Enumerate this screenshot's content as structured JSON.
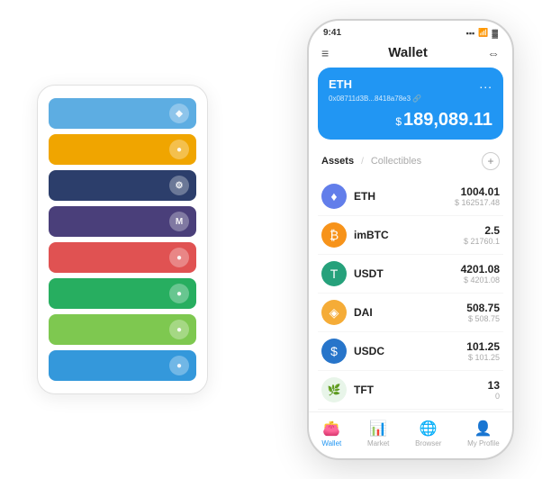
{
  "scene": {
    "card_stack": {
      "items": [
        {
          "color": "#5DADE2",
          "icon": "◆"
        },
        {
          "color": "#F0A500",
          "icon": "●"
        },
        {
          "color": "#2C3E6B",
          "icon": "⚙"
        },
        {
          "color": "#4A3F7A",
          "icon": "M"
        },
        {
          "color": "#E05252",
          "icon": "●"
        },
        {
          "color": "#27AE60",
          "icon": "●"
        },
        {
          "color": "#7EC850",
          "icon": "●"
        },
        {
          "color": "#3498DB",
          "icon": "●"
        }
      ]
    }
  },
  "phone": {
    "status_bar": {
      "time": "9:41",
      "signal": "▪▪▪",
      "wifi": "WiFi",
      "battery": "🔋"
    },
    "header": {
      "menu_icon": "≡",
      "title": "Wallet",
      "expand_icon": "⇔"
    },
    "eth_card": {
      "label": "ETH",
      "more": "...",
      "address": "0x08711d3B...8418a78e3 🔗",
      "currency_symbol": "$",
      "balance": "189,089.11"
    },
    "assets_section": {
      "tab_active": "Assets",
      "tab_divider": "/",
      "tab_inactive": "Collectibles",
      "add_label": "+"
    },
    "assets": [
      {
        "name": "ETH",
        "amount": "1004.01",
        "usd": "$ 162517.48",
        "icon": "♦",
        "icon_bg": "#627EEA",
        "icon_color": "#fff"
      },
      {
        "name": "imBTC",
        "amount": "2.5",
        "usd": "$ 21760.1",
        "icon": "₿",
        "icon_bg": "#F7931A",
        "icon_color": "#fff"
      },
      {
        "name": "USDT",
        "amount": "4201.08",
        "usd": "$ 4201.08",
        "icon": "T",
        "icon_bg": "#26A17B",
        "icon_color": "#fff"
      },
      {
        "name": "DAI",
        "amount": "508.75",
        "usd": "$ 508.75",
        "icon": "◈",
        "icon_bg": "#F5AC37",
        "icon_color": "#fff"
      },
      {
        "name": "USDC",
        "amount": "101.25",
        "usd": "$ 101.25",
        "icon": "$",
        "icon_bg": "#2775CA",
        "icon_color": "#fff"
      },
      {
        "name": "TFT",
        "amount": "13",
        "usd": "0",
        "icon": "🌿",
        "icon_bg": "#E8F5E9",
        "icon_color": "#4CAF50"
      }
    ],
    "bottom_nav": [
      {
        "label": "Wallet",
        "icon": "👛",
        "active": true
      },
      {
        "label": "Market",
        "icon": "📊",
        "active": false
      },
      {
        "label": "Browser",
        "icon": "🌐",
        "active": false
      },
      {
        "label": "My Profile",
        "icon": "👤",
        "active": false
      }
    ]
  }
}
